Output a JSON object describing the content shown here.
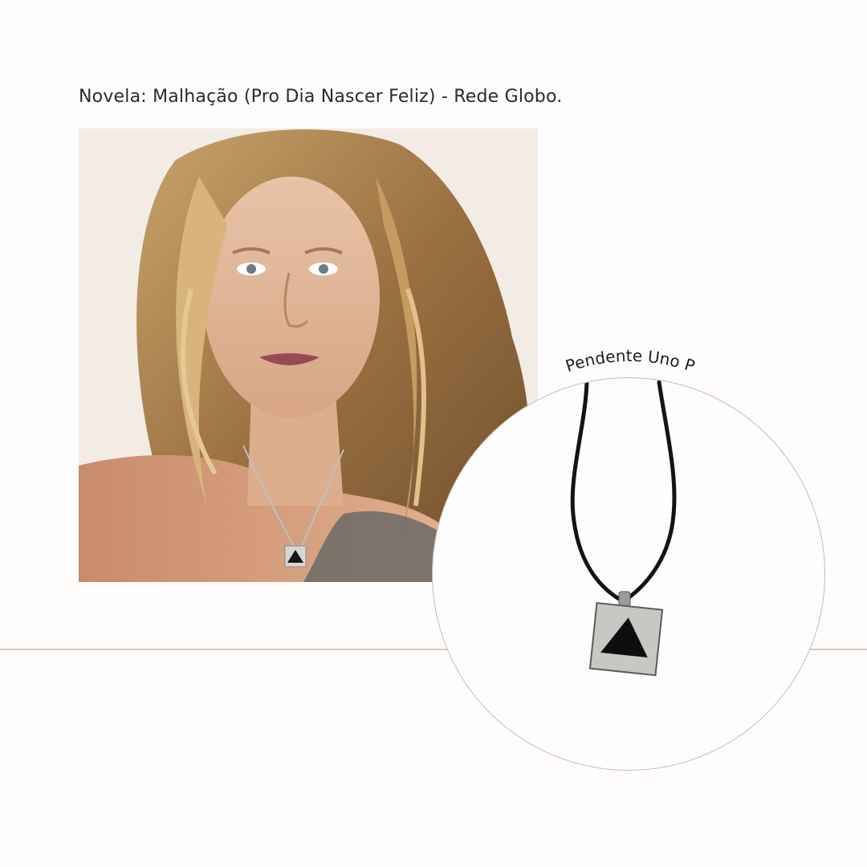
{
  "caption": {
    "text": "Novela: Malhação (Pro Dia Nascer Feliz) - Rede Globo."
  },
  "photo": {
    "subject": "woman-wearing-pendant"
  },
  "product": {
    "label": "Pendente Uno P",
    "icon": "pendant-necklace-icon"
  },
  "colors": {
    "background": "#fefdfc",
    "divider": "#d6c9c0",
    "circle_border": "#cdb8ae",
    "text": "#2a2a2a"
  }
}
